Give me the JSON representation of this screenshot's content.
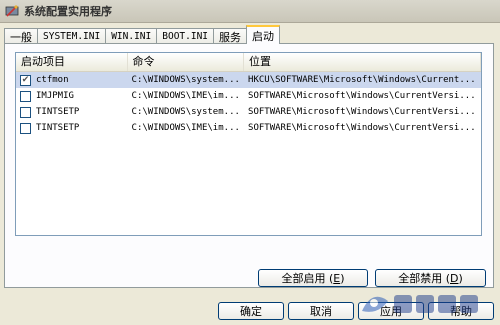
{
  "window": {
    "title": "系统配置实用程序",
    "icon": "msconfig-icon"
  },
  "tabs": [
    {
      "label": "一般",
      "active": false
    },
    {
      "label": "SYSTEM.INI",
      "active": false
    },
    {
      "label": "WIN.INI",
      "active": false
    },
    {
      "label": "BOOT.INI",
      "active": false
    },
    {
      "label": "服务",
      "active": false
    },
    {
      "label": "启动",
      "active": true
    }
  ],
  "startup_list": {
    "columns": [
      "启动项目",
      "命令",
      "位置"
    ],
    "rows": [
      {
        "checked": true,
        "selected": true,
        "item": "ctfmon",
        "command": "C:\\WINDOWS\\system...",
        "location": "HKCU\\SOFTWARE\\Microsoft\\Windows\\Current..."
      },
      {
        "checked": false,
        "selected": false,
        "item": "IMJPMIG",
        "command": "C:\\WINDOWS\\IME\\im...",
        "location": "SOFTWARE\\Microsoft\\Windows\\CurrentVersi..."
      },
      {
        "checked": false,
        "selected": false,
        "item": "TINTSETP",
        "command": "C:\\WINDOWS\\system...",
        "location": "SOFTWARE\\Microsoft\\Windows\\CurrentVersi..."
      },
      {
        "checked": false,
        "selected": false,
        "item": "TINTSETP",
        "command": "C:\\WINDOWS\\IME\\im...",
        "location": "SOFTWARE\\Microsoft\\Windows\\CurrentVersi..."
      }
    ]
  },
  "buttons": {
    "enable_all": {
      "text": "全部启用 (",
      "key": "E",
      "close": ")"
    },
    "disable_all": {
      "text": "全部禁用 (",
      "key": "D",
      "close": ")"
    },
    "ok": "确定",
    "cancel": "取消",
    "apply": "应用",
    "help": "帮助"
  }
}
